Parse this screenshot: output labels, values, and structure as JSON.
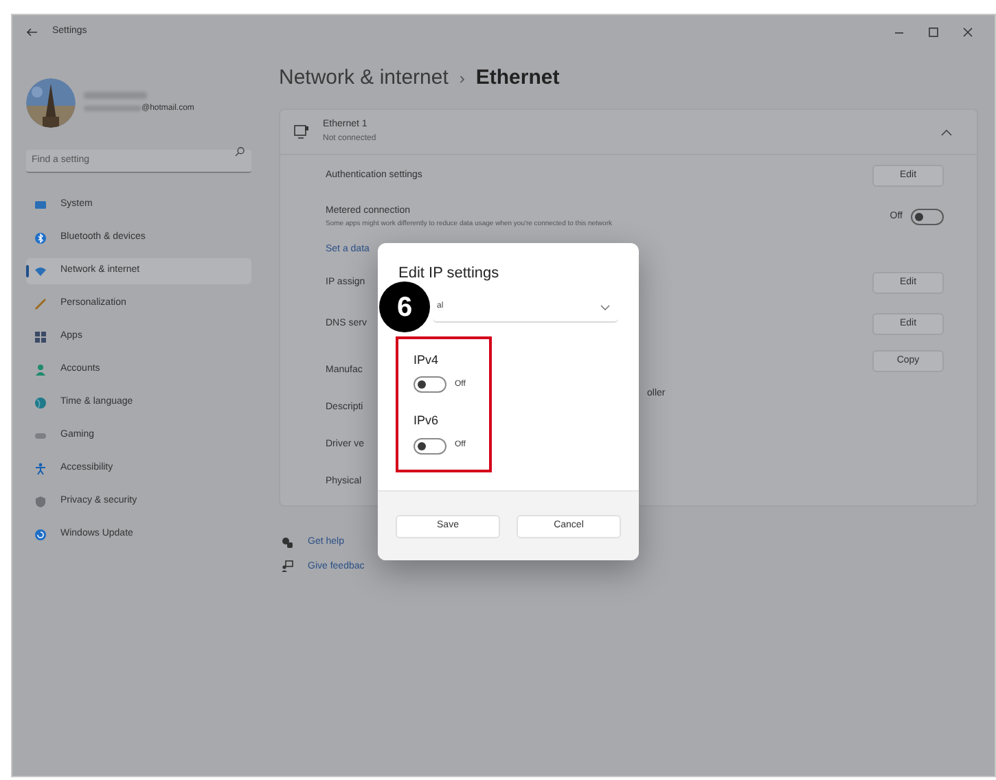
{
  "window": {
    "title": "Settings"
  },
  "account": {
    "email": "@hotmail.com"
  },
  "search": {
    "placeholder": "Find a setting"
  },
  "sidebar": {
    "items": [
      {
        "label": "System",
        "selected": false
      },
      {
        "label": "Bluetooth & devices",
        "selected": false
      },
      {
        "label": "Network & internet",
        "selected": true
      },
      {
        "label": "Personalization",
        "selected": false
      },
      {
        "label": "Apps",
        "selected": false
      },
      {
        "label": "Accounts",
        "selected": false
      },
      {
        "label": "Time & language",
        "selected": false
      },
      {
        "label": "Gaming",
        "selected": false
      },
      {
        "label": "Accessibility",
        "selected": false
      },
      {
        "label": "Privacy & security",
        "selected": false
      },
      {
        "label": "Windows Update",
        "selected": false
      }
    ]
  },
  "breadcrumb": {
    "parent": "Network & internet",
    "separator": "›",
    "current": "Ethernet"
  },
  "adapter": {
    "name": "Ethernet 1",
    "status": "Not connected",
    "expanded": true
  },
  "settings_rows": [
    {
      "kind": "button",
      "label": "Authentication settings",
      "button": "Edit"
    },
    {
      "kind": "toggle",
      "label": "Metered connection",
      "description": "Some apps might work differently to reduce data usage when you're connected to this network",
      "state_label": "Off",
      "on": false
    },
    {
      "kind": "link",
      "label": "Set a data"
    },
    {
      "kind": "button",
      "label": "IP assign",
      "button": "Edit"
    },
    {
      "kind": "button",
      "label": "DNS serv",
      "button": "Edit"
    },
    {
      "kind": "properties",
      "button": "Copy",
      "items": [
        {
          "label": "Manufac"
        },
        {
          "label": "Descripti",
          "value": "oller"
        },
        {
          "label": "Driver ve"
        },
        {
          "label": "Physical"
        }
      ]
    }
  ],
  "help_links": [
    {
      "label": "Get help"
    },
    {
      "label": "Give feedbac"
    }
  ],
  "dialog": {
    "title": "Edit IP settings",
    "dropdown_value": "al",
    "protocols": [
      {
        "label": "IPv4",
        "on": false,
        "state_label": "Off"
      },
      {
        "label": "IPv6",
        "on": false,
        "state_label": "Off"
      }
    ],
    "buttons": [
      "Save",
      "Cancel"
    ],
    "callout": {
      "number": "6"
    }
  }
}
